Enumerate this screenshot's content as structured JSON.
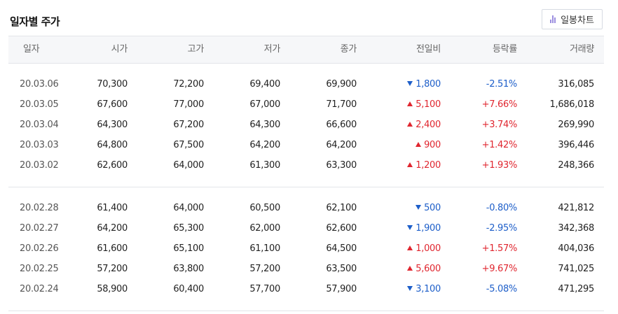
{
  "title": "일자별 주가",
  "chart_button": {
    "label": "일봉차트",
    "icon": "bar-chart-icon",
    "icon_color": "#9c8fe0"
  },
  "colors": {
    "up": "#e0262f",
    "down": "#1d5ec9"
  },
  "columns": [
    "일자",
    "시가",
    "고가",
    "저가",
    "종가",
    "전일비",
    "등락률",
    "거래량"
  ],
  "groups": [
    [
      {
        "date": "20.03.06",
        "open": "70,300",
        "high": "72,200",
        "low": "69,400",
        "close": "69,900",
        "dir": "down",
        "change": "1,800",
        "rate": "-2.51%",
        "volume": "316,085"
      },
      {
        "date": "20.03.05",
        "open": "67,600",
        "high": "77,000",
        "low": "67,000",
        "close": "71,700",
        "dir": "up",
        "change": "5,100",
        "rate": "+7.66%",
        "volume": "1,686,018"
      },
      {
        "date": "20.03.04",
        "open": "64,300",
        "high": "67,200",
        "low": "64,300",
        "close": "66,600",
        "dir": "up",
        "change": "2,400",
        "rate": "+3.74%",
        "volume": "269,990"
      },
      {
        "date": "20.03.03",
        "open": "64,800",
        "high": "67,500",
        "low": "64,200",
        "close": "64,200",
        "dir": "up",
        "change": "900",
        "rate": "+1.42%",
        "volume": "396,446"
      },
      {
        "date": "20.03.02",
        "open": "62,600",
        "high": "64,000",
        "low": "61,300",
        "close": "63,300",
        "dir": "up",
        "change": "1,200",
        "rate": "+1.93%",
        "volume": "248,366"
      }
    ],
    [
      {
        "date": "20.02.28",
        "open": "61,400",
        "high": "64,000",
        "low": "60,500",
        "close": "62,100",
        "dir": "down",
        "change": "500",
        "rate": "-0.80%",
        "volume": "421,812"
      },
      {
        "date": "20.02.27",
        "open": "64,200",
        "high": "65,300",
        "low": "62,000",
        "close": "62,600",
        "dir": "down",
        "change": "1,900",
        "rate": "-2.95%",
        "volume": "342,368"
      },
      {
        "date": "20.02.26",
        "open": "61,600",
        "high": "65,100",
        "low": "61,100",
        "close": "64,500",
        "dir": "up",
        "change": "1,000",
        "rate": "+1.57%",
        "volume": "404,036"
      },
      {
        "date": "20.02.25",
        "open": "57,200",
        "high": "63,800",
        "low": "57,200",
        "close": "63,500",
        "dir": "up",
        "change": "5,600",
        "rate": "+9.67%",
        "volume": "741,025"
      },
      {
        "date": "20.02.24",
        "open": "58,900",
        "high": "60,400",
        "low": "57,700",
        "close": "57,900",
        "dir": "down",
        "change": "3,100",
        "rate": "-5.08%",
        "volume": "471,295"
      }
    ]
  ]
}
